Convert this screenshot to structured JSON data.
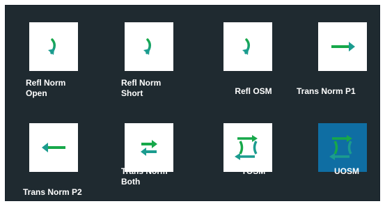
{
  "colors": {
    "panel_bg": "#1f2a30",
    "tile_bg": "#ffffff",
    "selected_tile_bg": "#0f6ea3",
    "arrow_green": "#17a84a",
    "arrow_teal": "#1b9c8f"
  },
  "cal_types": [
    {
      "line1": "Refl Norm",
      "line2": "Open",
      "icon": "reflect-arrow-icon",
      "selected": false
    },
    {
      "line1": "Refl Norm",
      "line2": "Short",
      "icon": "reflect-arrow-icon",
      "selected": false
    },
    {
      "line1": "Refl OSM",
      "line2": "",
      "icon": "reflect-arrow-icon",
      "selected": false
    },
    {
      "line1": "Trans Norm P1",
      "line2": "",
      "icon": "right-arrow-icon",
      "selected": false
    },
    {
      "line1": "Trans Norm P2",
      "line2": "",
      "icon": "left-arrow-icon",
      "selected": false
    },
    {
      "line1": "Trans Norm",
      "line2": "Both",
      "icon": "bidirectional-arrows-icon",
      "selected": false
    },
    {
      "line1": "TOSM",
      "line2": "",
      "icon": "full-two-port-icon",
      "selected": false
    },
    {
      "line1": "UOSM",
      "line2": "",
      "icon": "full-two-port-icon",
      "selected": true
    }
  ]
}
